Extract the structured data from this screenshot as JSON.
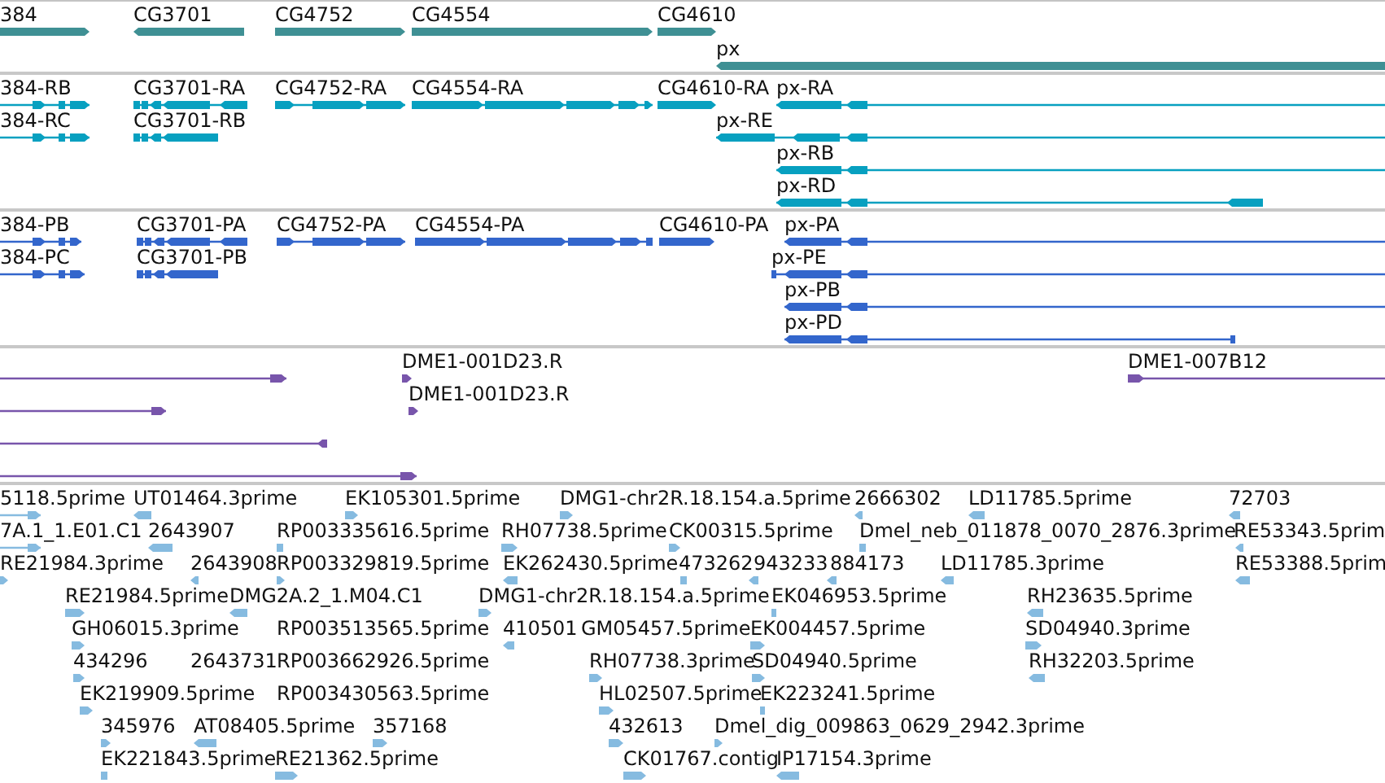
{
  "tracks": [
    {
      "kind": "gene",
      "features": [
        {
          "label": "384"
        },
        {
          "label": "CG3701"
        },
        {
          "label": "CG4752"
        },
        {
          "label": "CG4554"
        },
        {
          "label": "CG4610"
        },
        {
          "label": "px"
        }
      ]
    },
    {
      "kind": "mrna",
      "features": [
        {
          "label": "384-RB"
        },
        {
          "label": "384-RC"
        },
        {
          "label": "CG3701-RA"
        },
        {
          "label": "CG3701-RB"
        },
        {
          "label": "CG4752-RA"
        },
        {
          "label": "CG4554-RA"
        },
        {
          "label": "CG4610-RA"
        },
        {
          "label": "px-RA"
        },
        {
          "label": "px-RE"
        },
        {
          "label": "px-RB"
        },
        {
          "label": "px-RD"
        }
      ]
    },
    {
      "kind": "protein",
      "features": [
        {
          "label": "384-PB"
        },
        {
          "label": "384-PC"
        },
        {
          "label": "CG3701-PA"
        },
        {
          "label": "CG3701-PB"
        },
        {
          "label": "CG4752-PA"
        },
        {
          "label": "CG4554-PA"
        },
        {
          "label": "CG4610-PA"
        },
        {
          "label": "px-PA"
        },
        {
          "label": "px-PE"
        },
        {
          "label": "px-PB"
        },
        {
          "label": "px-PD"
        }
      ]
    },
    {
      "kind": "clone",
      "features": [
        {
          "label": "DME1-001D23.R"
        },
        {
          "label": "DME1-001D23.R"
        },
        {
          "label": "DME1-007B12"
        }
      ]
    },
    {
      "kind": "est",
      "features": [
        {
          "label": "5118.5prime"
        },
        {
          "label": "UT01464.3prime"
        },
        {
          "label": "EK105301.5prime"
        },
        {
          "label": "DMG1-chr2R.18.154.a.5prime"
        },
        {
          "label": "2666302"
        },
        {
          "label": "LD11785.5prime"
        },
        {
          "label": "72703"
        },
        {
          "label": "7A.1_1.E01.C1"
        },
        {
          "label": "2643907"
        },
        {
          "label": "RP003335616.5prime"
        },
        {
          "label": "RH07738.5prime"
        },
        {
          "label": "CK00315.5prime"
        },
        {
          "label": "Dmel_neb_011878_0070_2876.3prime"
        },
        {
          "label": "RE53343.5prim"
        },
        {
          "label": "RE21984.3prime"
        },
        {
          "label": "2643908"
        },
        {
          "label": "RP003329819.5prime"
        },
        {
          "label": "EK262430.5prime"
        },
        {
          "label": "473262"
        },
        {
          "label": "943233"
        },
        {
          "label": "884173"
        },
        {
          "label": "LD11785.3prime"
        },
        {
          "label": "RE53388.5prim"
        },
        {
          "label": "RE21984.5prime"
        },
        {
          "label": "DMG2A.2_1.M04.C1"
        },
        {
          "label": "DMG1-chr2R.18.154.a.5prime"
        },
        {
          "label": "EK046953.5prime"
        },
        {
          "label": "RH23635.5prime"
        },
        {
          "label": "GH06015.3prime"
        },
        {
          "label": "RP003513565.5prime"
        },
        {
          "label": "410501"
        },
        {
          "label": "GM05457.5prime"
        },
        {
          "label": "EK004457.5prime"
        },
        {
          "label": "SD04940.3prime"
        },
        {
          "label": "434296"
        },
        {
          "label": "2643731"
        },
        {
          "label": "RP003662926.5prime"
        },
        {
          "label": "RH07738.3prime"
        },
        {
          "label": "SD04940.5prime"
        },
        {
          "label": "RH32203.5prime"
        },
        {
          "label": "EK219909.5prime"
        },
        {
          "label": "RP003430563.5prime"
        },
        {
          "label": "HL02507.5prime"
        },
        {
          "label": "EK223241.5prime"
        },
        {
          "label": "345976"
        },
        {
          "label": "AT08405.5prime"
        },
        {
          "label": "357168"
        },
        {
          "label": "432613"
        },
        {
          "label": "Dmel_dig_009863_0629_2942.3prime"
        },
        {
          "label": "EK221843.5prime"
        },
        {
          "label": "RE21362.5prime"
        },
        {
          "label": "CK01767.contig"
        },
        {
          "label": "IP17154.3prime"
        }
      ]
    }
  ]
}
